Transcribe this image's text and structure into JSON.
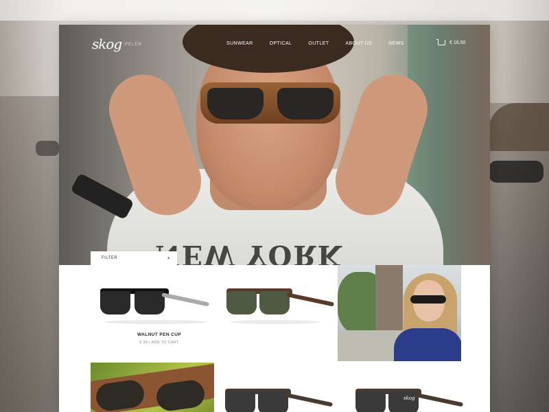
{
  "brand": {
    "logo": "skog",
    "sub": "PELEN"
  },
  "nav": {
    "items": [
      "SUNWEAR",
      "OPTICAL",
      "OUTLET",
      "ABOUT US",
      "NEWS"
    ]
  },
  "cart": {
    "total": "€ 16,50"
  },
  "hero": {
    "shirt_print": "NEW YORK"
  },
  "filter": {
    "label": "FILTER"
  },
  "products": [
    {
      "name": "WALNUT PEN CUP",
      "price": "€ 39",
      "action": "ADD TO CART"
    }
  ],
  "product_badge": "skog",
  "colors": {
    "accent": "#ffffff",
    "wood": "#8b5531"
  }
}
